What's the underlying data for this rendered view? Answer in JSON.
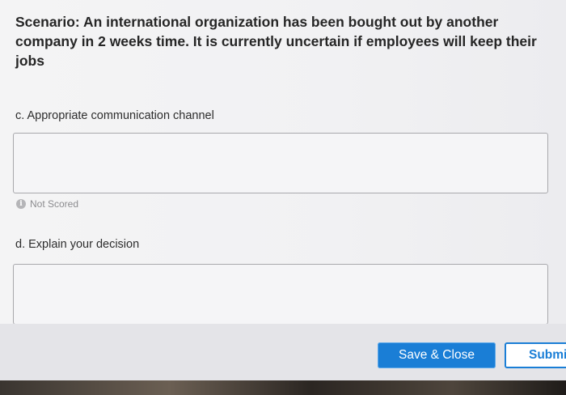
{
  "scenario": {
    "text": "Scenario: An international organization has been bought out by another company in 2 weeks time. It is currently uncertain if employees will keep their jobs"
  },
  "questions": [
    {
      "label": "c. Appropriate communication channel",
      "answer_value": "",
      "status": "Not Scored"
    },
    {
      "label": "d. Explain your decision",
      "answer_value": ""
    }
  ],
  "buttons": {
    "save_close": "Save & Close",
    "submit": "Submit"
  },
  "icons": {
    "status_icon": "info-icon"
  },
  "colors": {
    "primary_button": "#1a7ed6"
  }
}
